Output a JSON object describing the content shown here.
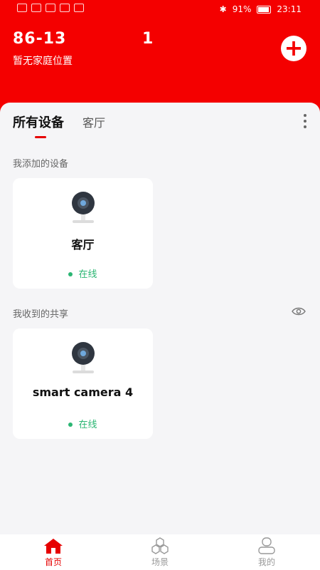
{
  "status_bar": {
    "battery": "91%",
    "time": "23:11"
  },
  "header": {
    "phone_prefix": "86-13",
    "phone_suffix": "1",
    "location": "暂无家庭位置",
    "add_label": "+"
  },
  "tabs": [
    {
      "label": "所有设备",
      "active": true
    },
    {
      "label": "客厅",
      "active": false
    }
  ],
  "sections": {
    "added_title": "我添加的设备",
    "shared_title": "我收到的共享"
  },
  "devices_added": [
    {
      "name": "客厅",
      "status": "在线",
      "icon": "camera-icon"
    }
  ],
  "devices_shared": [
    {
      "name": "smart camera 4",
      "status": "在线",
      "icon": "camera-icon"
    }
  ],
  "bottom_nav": [
    {
      "label": "首页",
      "icon": "home-icon",
      "active": true
    },
    {
      "label": "场景",
      "icon": "scene-icon",
      "active": false
    },
    {
      "label": "我的",
      "icon": "profile-icon",
      "active": false
    }
  ],
  "colors": {
    "brand": "#f40000",
    "online": "#2bb673"
  }
}
